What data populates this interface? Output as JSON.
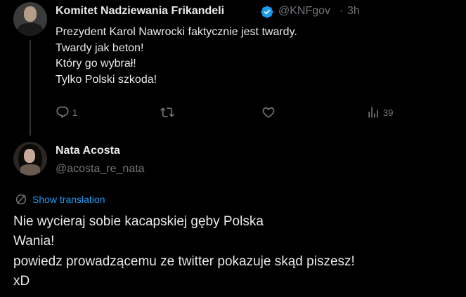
{
  "parent_tweet": {
    "author_name": "Komitet Nadziewania Frikandeli",
    "handle": "@KNFgov",
    "separator": "·",
    "time": "3h",
    "lines": [
      "Prezydent Karol Nawrocki faktycznie jest twardy.",
      "Twardy jak beton!",
      "Który go wybrał!",
      "Tylko Polski szkoda!"
    ],
    "actions": {
      "reply_count": "1",
      "repost_count": "",
      "like_count": "",
      "views_count": "39"
    }
  },
  "reply_tweet": {
    "author_name": "Nata Acosta",
    "handle": "@acosta_re_nata",
    "show_translation": "Show translation",
    "lines": [
      "Nie wycieraj sobie kacapskiej gęby Polska",
      "Wania!",
      "powiedz prowadzącemu ze twitter pokazuje skąd piszesz!",
      "xD"
    ]
  },
  "colors": {
    "background": "#000000",
    "text_primary": "#e7e9ea",
    "text_secondary": "#71767b",
    "accent": "#1d9bf0",
    "thread_line": "#333639"
  },
  "icons": {
    "reply": "reply-icon",
    "repost": "repost-icon",
    "like": "like-icon",
    "views": "views-icon",
    "verified": "verified-badge-icon",
    "translate": "translate-icon"
  }
}
